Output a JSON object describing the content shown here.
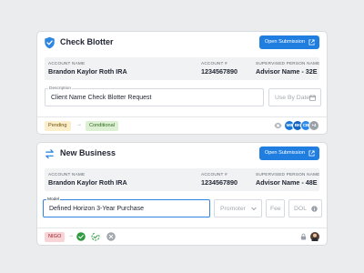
{
  "cards": [
    {
      "title": "Check Blotter",
      "title_icon": "shield-check-icon",
      "open_button": "Open Submission",
      "info": {
        "account_name_label": "ACCOUNT NAME",
        "account_name": "Brandon Kaylor Roth IRA",
        "account_number_label": "ACCOUNT #",
        "account_number": "1234567890",
        "supervised_label": "SUPERVISED PERSON NAME",
        "supervised": "Advisor Name - 32E"
      },
      "description_label": "Description",
      "description_value": "Client Name Check Blotter Request",
      "date_placeholder": "Use By Date",
      "status_from": "Pending",
      "status_to": "Conditional",
      "avatars": [
        "MB",
        "BK",
        "CB",
        "+4"
      ],
      "avatar_colors": [
        "#1a78d8",
        "#1465c0",
        "#2a88e8",
        "#9aa0a8"
      ]
    },
    {
      "title": "New Business",
      "title_icon": "swap-arrows-icon",
      "open_button": "Open Submission",
      "info": {
        "account_name_label": "ACCOUNT NAME",
        "account_name": "Brandon Kaylor Roth IRA",
        "account_number_label": "ACCOUNT #",
        "account_number": "1234567890",
        "supervised_label": "SUPERVISED PERSON NAME",
        "supervised": "Advisor Name - 48E"
      },
      "model_label": "Model",
      "model_value": "Defined Horizon 3-Year Purchase",
      "promoter_placeholder": "Promoter",
      "fee_placeholder": "Fee",
      "dol_placeholder": "DOL",
      "status_from": "NIGO"
    }
  ],
  "colors": {
    "accent": "#1f7ee0",
    "success": "#2e9b3e"
  }
}
